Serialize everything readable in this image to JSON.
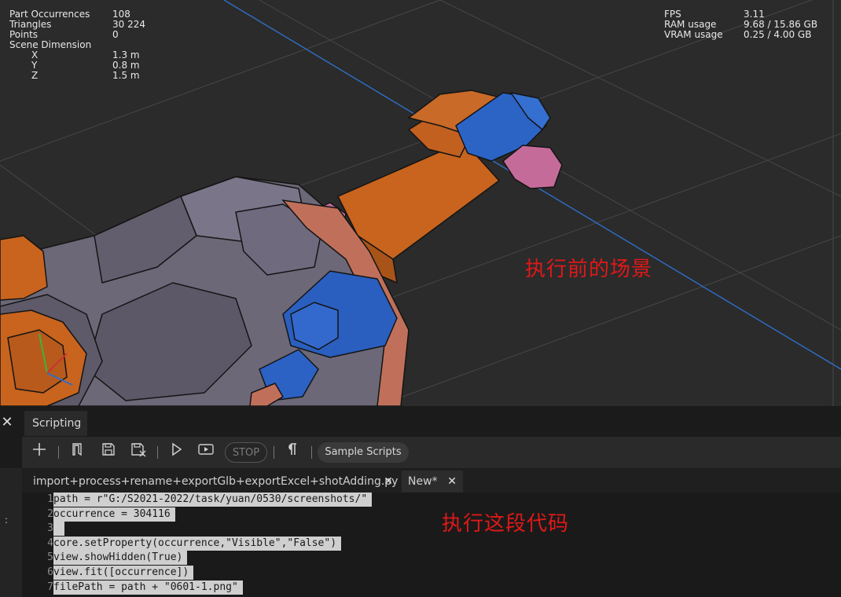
{
  "stats_left": [
    {
      "key": "Part Occurrences",
      "value": "108",
      "indent": false
    },
    {
      "key": "Triangles",
      "value": "30 224",
      "indent": false
    },
    {
      "key": "Points",
      "value": "0",
      "indent": false
    },
    {
      "key": "Scene Dimension",
      "value": "",
      "indent": false
    },
    {
      "key": "X",
      "value": "1.3 m",
      "indent": true
    },
    {
      "key": "Y",
      "value": "0.8 m",
      "indent": true
    },
    {
      "key": "Z",
      "value": "1.5 m",
      "indent": true
    }
  ],
  "stats_right": [
    {
      "key": "FPS",
      "value": "3.11"
    },
    {
      "key": "RAM usage",
      "value": "9.68 / 15.86 GB"
    },
    {
      "key": "VRAM usage",
      "value": "0.25 / 4.00 GB"
    }
  ],
  "annotations": {
    "scene": "执行前的场景",
    "code": "执行这段代码"
  },
  "panel": {
    "close_glyph": "✕",
    "tab_label": "Scripting",
    "stop_label": "STOP",
    "sample_label": "Sample Scripts",
    "gutter_glyph": ":"
  },
  "toolbar_icons": [
    "plus-icon",
    "bookmark-icon",
    "save-icon",
    "save-as-icon",
    "play-icon",
    "run-video-icon",
    "stop",
    "pilcrow-icon",
    "sample-scripts"
  ],
  "file_tabs": [
    {
      "label": "import+process+rename+exportGlb+exportExcel+shotAdding.py",
      "close": "✕"
    },
    {
      "label": "New*",
      "close": "✕"
    }
  ],
  "code_lines": [
    {
      "num": "1",
      "text": "path = r\"G:/S2021-2022/task/yuan/0530/screenshots/\""
    },
    {
      "num": "2",
      "text": "occurrence = 304116"
    },
    {
      "num": "3",
      "text": " "
    },
    {
      "num": "4",
      "text": "core.setProperty(occurrence,\"Visible\",\"False\")"
    },
    {
      "num": "5",
      "text": "view.showHidden(True)"
    },
    {
      "num": "6",
      "text": "view.fit([occurrence])"
    },
    {
      "num": "7",
      "text": "filePath = path + \"0601-1.png\""
    }
  ],
  "colors": {
    "viewport_bg": "#2b2b2b",
    "grid_line": "#4a4a4a",
    "axis_blue": "#2f6fc8",
    "orange": "#c8631e",
    "blue_part": "#2a62c4",
    "pink": "#c86a9c",
    "gray_body": "#6b6677",
    "annotation_red": "#e01818"
  }
}
